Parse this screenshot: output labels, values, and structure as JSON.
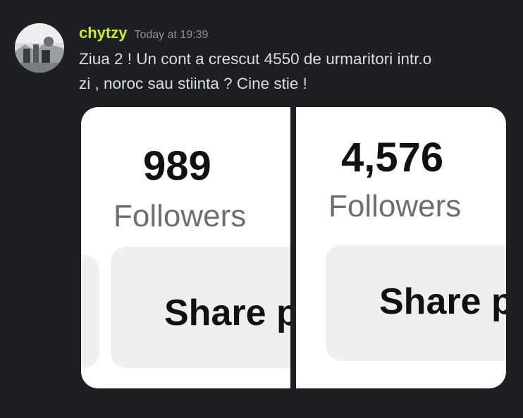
{
  "message": {
    "author": "chytzy",
    "timestamp": "Today at 19:39",
    "text_line1": "Ziua 2 ! Un cont a crescut 4550 de urmaritori intr.o",
    "text_line2": "zi , noroc sau stiinta ? Cine stie !",
    "username_color": "#c4ee30",
    "avatar_icon": "user-photo-avatar"
  },
  "screenshots": [
    {
      "count": "989",
      "label": "Followers",
      "button_text": "Share p"
    },
    {
      "count": "4,576",
      "label": "Followers",
      "button_text": "Share p"
    }
  ]
}
